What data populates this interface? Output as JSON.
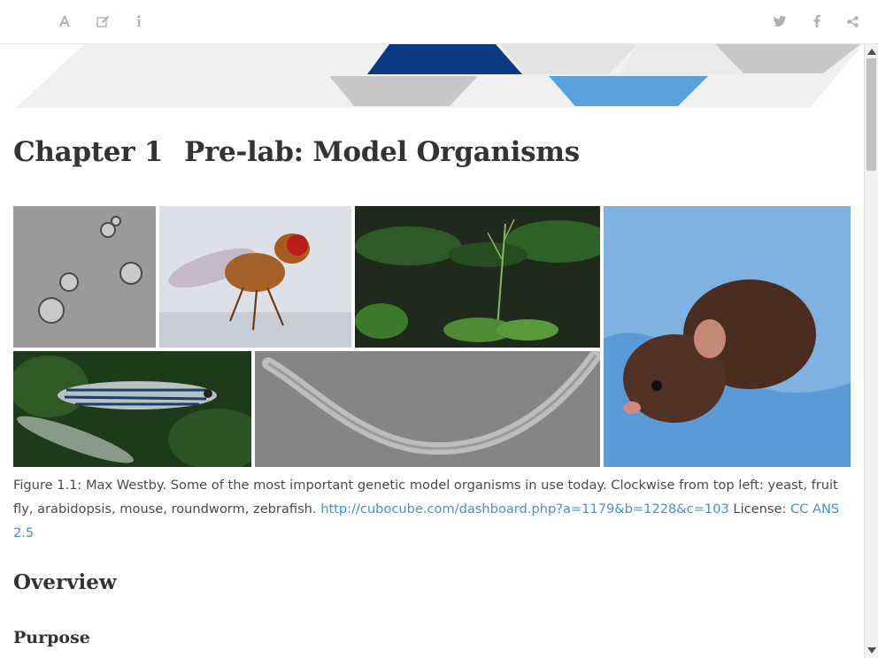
{
  "toolbar": {
    "left_icons": [
      "font-settings-icon",
      "edit-icon",
      "info-icon"
    ],
    "right_icons": [
      "twitter-icon",
      "facebook-icon",
      "share-icon"
    ],
    "icon_color": "#b0b0b0"
  },
  "chapter": {
    "number": "Chapter 1",
    "title": "Pre-lab: Model Organisms"
  },
  "figure": {
    "panels": [
      "yeast",
      "fruit fly",
      "arabidopsis",
      "mouse",
      "zebrafish",
      "roundworm"
    ],
    "caption_text": "Figure 1.1: Max Westby. Some of the most important genetic model organisms in use today. Clockwise from top left: yeast, fruit fly, arabidopsis, mouse, roundworm, zebrafish. ",
    "link_text": "http://cubocube.com/dashboard.php?a=1179&b=1228&c=103",
    "license_label": " License: ",
    "license_link_text": "CC ANS 2.5",
    "link_color": "#4a90c8"
  },
  "sections": {
    "overview": "Overview",
    "purpose": "Purpose"
  },
  "colors": {
    "banner_dark_blue": "#0a3a82",
    "banner_light_blue": "#5aa0dc",
    "banner_grey": "#c8c8c8",
    "banner_light_grey": "#ececec"
  }
}
